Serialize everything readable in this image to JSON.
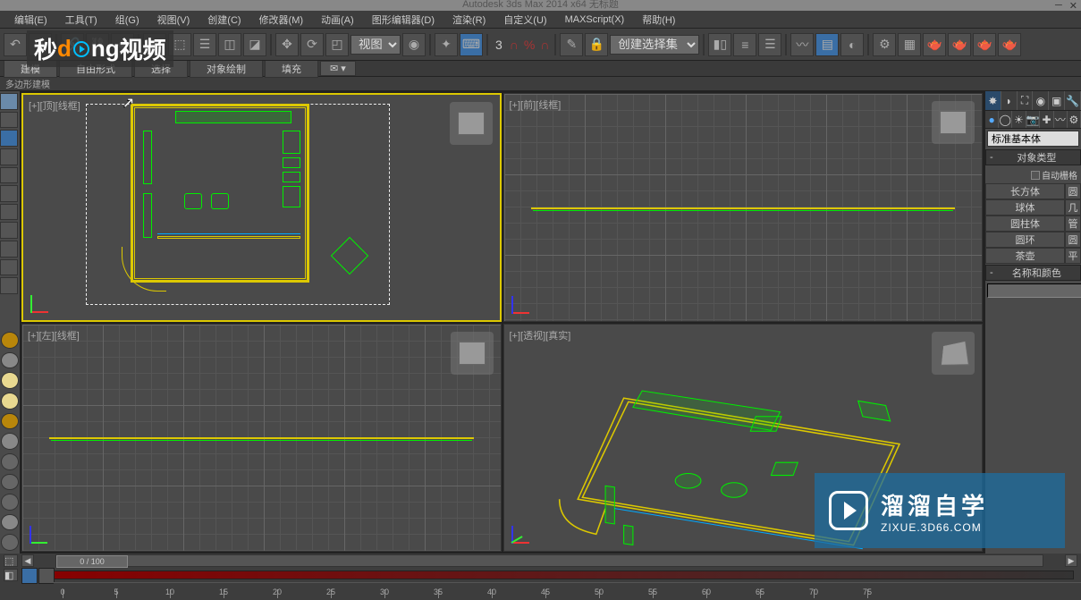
{
  "title": "Autodesk 3ds Max 2014 x64   无标题",
  "menu": [
    "编辑(E)",
    "工具(T)",
    "组(G)",
    "视图(V)",
    "创建(C)",
    "修改器(M)",
    "动画(A)",
    "图形编辑器(D)",
    "渲染(R)",
    "自定义(U)",
    "MAXScript(X)",
    "帮助(H)"
  ],
  "logo_text": {
    "a": "秒",
    "b": "d",
    "c": "ng",
    "d": "视频"
  },
  "toolbar": {
    "view_dropdown": "视图",
    "selection_set": "创建选择集",
    "snap_num": "3"
  },
  "sub_tabs": [
    "建模",
    "自由形式",
    "选择",
    "对象绘制",
    "填充"
  ],
  "ribbon": "多边形建模",
  "viewports": {
    "tl": "[+][顶][线框]",
    "tr": "[+][前][线框]",
    "bl": "[+][左][线框]",
    "br": "[+][透视][真实]"
  },
  "right": {
    "category": "标准基本体",
    "obj_type_header": "对象类型",
    "auto_grid": "自动栅格",
    "primitives_left": [
      "长方体",
      "球体",
      "圆柱体",
      "圆环",
      "茶壶"
    ],
    "primitives_right": [
      "圆",
      "几",
      "管",
      "圆",
      "平"
    ],
    "name_color_header": "名称和颜色"
  },
  "timeline": {
    "frame": "0 / 100",
    "ticks": [
      0,
      5,
      10,
      15,
      20,
      25,
      30,
      35,
      40,
      45,
      50,
      55,
      60,
      65,
      70,
      75
    ]
  },
  "brand": {
    "main": "溜溜自学",
    "sub": "ZIXUE.3D66.COM"
  }
}
